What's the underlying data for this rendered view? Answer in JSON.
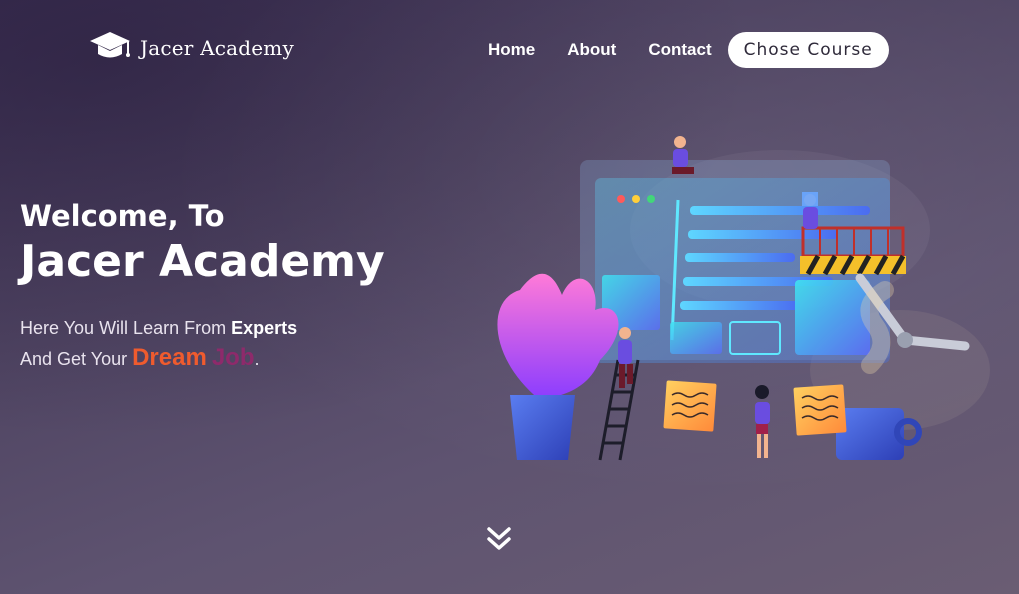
{
  "brand": {
    "name": "Jacer Academy",
    "icon": "graduation-cap-icon"
  },
  "nav": {
    "links": [
      "Home",
      "About",
      "Contact"
    ],
    "cta": "Chose Course"
  },
  "hero": {
    "welcome": "Welcome, To",
    "title": "Jacer Academy",
    "line1_prefix": "Here You Will Learn From ",
    "line1_strong": "Experts",
    "line2_prefix": "And Get Your ",
    "line2_dream": "Dream",
    "line2_job": "Job",
    "line2_suffix": "."
  },
  "scroll": {
    "icon": "double-chevron-down-icon"
  },
  "colors": {
    "background_top": "#3f3356",
    "background_bottom": "#6a5d73",
    "dream": "#ef5b2e",
    "job": "#8e2a6b",
    "cta_bg": "#ffffff"
  }
}
